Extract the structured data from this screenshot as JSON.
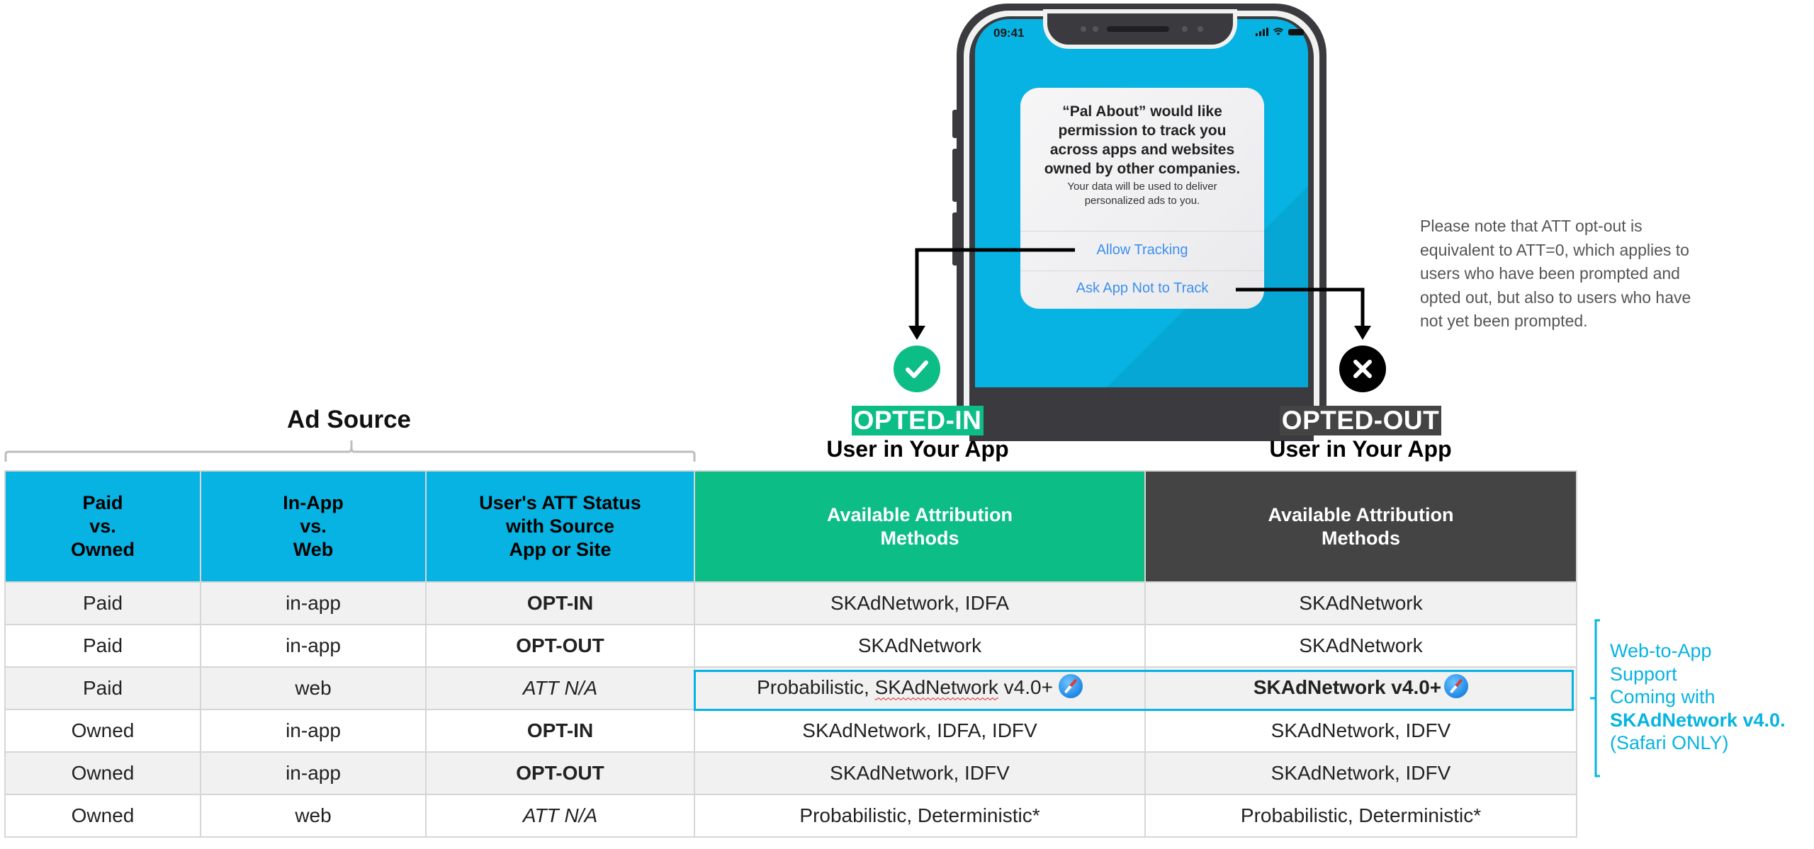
{
  "phone": {
    "time": "09:41",
    "dialog": {
      "title_lines": [
        "“Pal About” would like",
        "permission to track you",
        "across apps and websites",
        "owned by other companies."
      ],
      "message_lines": [
        "Your data will be used to deliver",
        "personalized ads to you."
      ],
      "allow_label": "Allow Tracking",
      "deny_label": "Ask App Not to Track"
    }
  },
  "icons": {
    "opted_in": "checkmark-icon",
    "opted_out": "x-icon",
    "safari": "safari-compass-icon"
  },
  "note": "Please note that ATT opt-out is equivalent to ATT=0, which applies to users who have been prompted and opted out, but also to users who have not yet been prompted.",
  "status_labels": {
    "opted_in": {
      "pill": "OPTED-IN",
      "sub": "User in Your App",
      "color": "#0cbd86"
    },
    "opted_out": {
      "pill": "OPTED-OUT",
      "sub": "User in Your App",
      "color": "#444444"
    }
  },
  "ad_source_title": "Ad Source",
  "table": {
    "headers": [
      {
        "lines": [
          "Paid",
          "vs.",
          "Owned"
        ],
        "color": "#07b3e2"
      },
      {
        "lines": [
          "In-App",
          "vs.",
          "Web"
        ],
        "color": "#07b3e2"
      },
      {
        "lines": [
          "User's ATT Status",
          "with Source",
          "App or Site"
        ],
        "color": "#07b3e2"
      },
      {
        "lines": [
          "Available Attribution",
          "Methods"
        ],
        "color": "#0cbd86"
      },
      {
        "lines": [
          "Available Attribution",
          "Methods"
        ],
        "color": "#444444"
      }
    ],
    "rows": [
      {
        "type": "Paid",
        "channel": "in-app",
        "att": "OPT-IN",
        "att_style": "optin",
        "opted_in": "SKAdNetwork, IDFA",
        "opted_out": "SKAdNetwork"
      },
      {
        "type": "Paid",
        "channel": "in-app",
        "att": "OPT-OUT",
        "att_style": "optout",
        "opted_in": "SKAdNetwork",
        "opted_out": "SKAdNetwork"
      },
      {
        "type": "Paid",
        "channel": "web",
        "att": "ATT N/A",
        "att_style": "na",
        "opted_in_prefix": "Probabilistic, ",
        "opted_in_flagged": "SKAdNetwork",
        "opted_in_suffix": " v4.0+",
        "opted_out": "SKAdNetwork v4.0+",
        "highlighted": true
      },
      {
        "type": "Owned",
        "channel": "in-app",
        "att": "OPT-IN",
        "att_style": "optin",
        "opted_in": "SKAdNetwork, IDFA, IDFV",
        "opted_out": "SKAdNetwork, IDFV"
      },
      {
        "type": "Owned",
        "channel": "in-app",
        "att": "OPT-OUT",
        "att_style": "optout",
        "opted_in": "SKAdNetwork, IDFV",
        "opted_out": "SKAdNetwork, IDFV"
      },
      {
        "type": "Owned",
        "channel": "web",
        "att": "ATT N/A",
        "att_style": "na",
        "opted_in": "Probabilistic, Deterministic*",
        "opted_out": "Probabilistic, Deterministic*"
      }
    ]
  },
  "callout": {
    "lines": [
      "Web-to-App",
      "Support",
      "Coming with"
    ],
    "bold_line": "SKAdNetwork v4.0.",
    "last_line": "(Safari ONLY)",
    "color": "#07b3e2"
  }
}
